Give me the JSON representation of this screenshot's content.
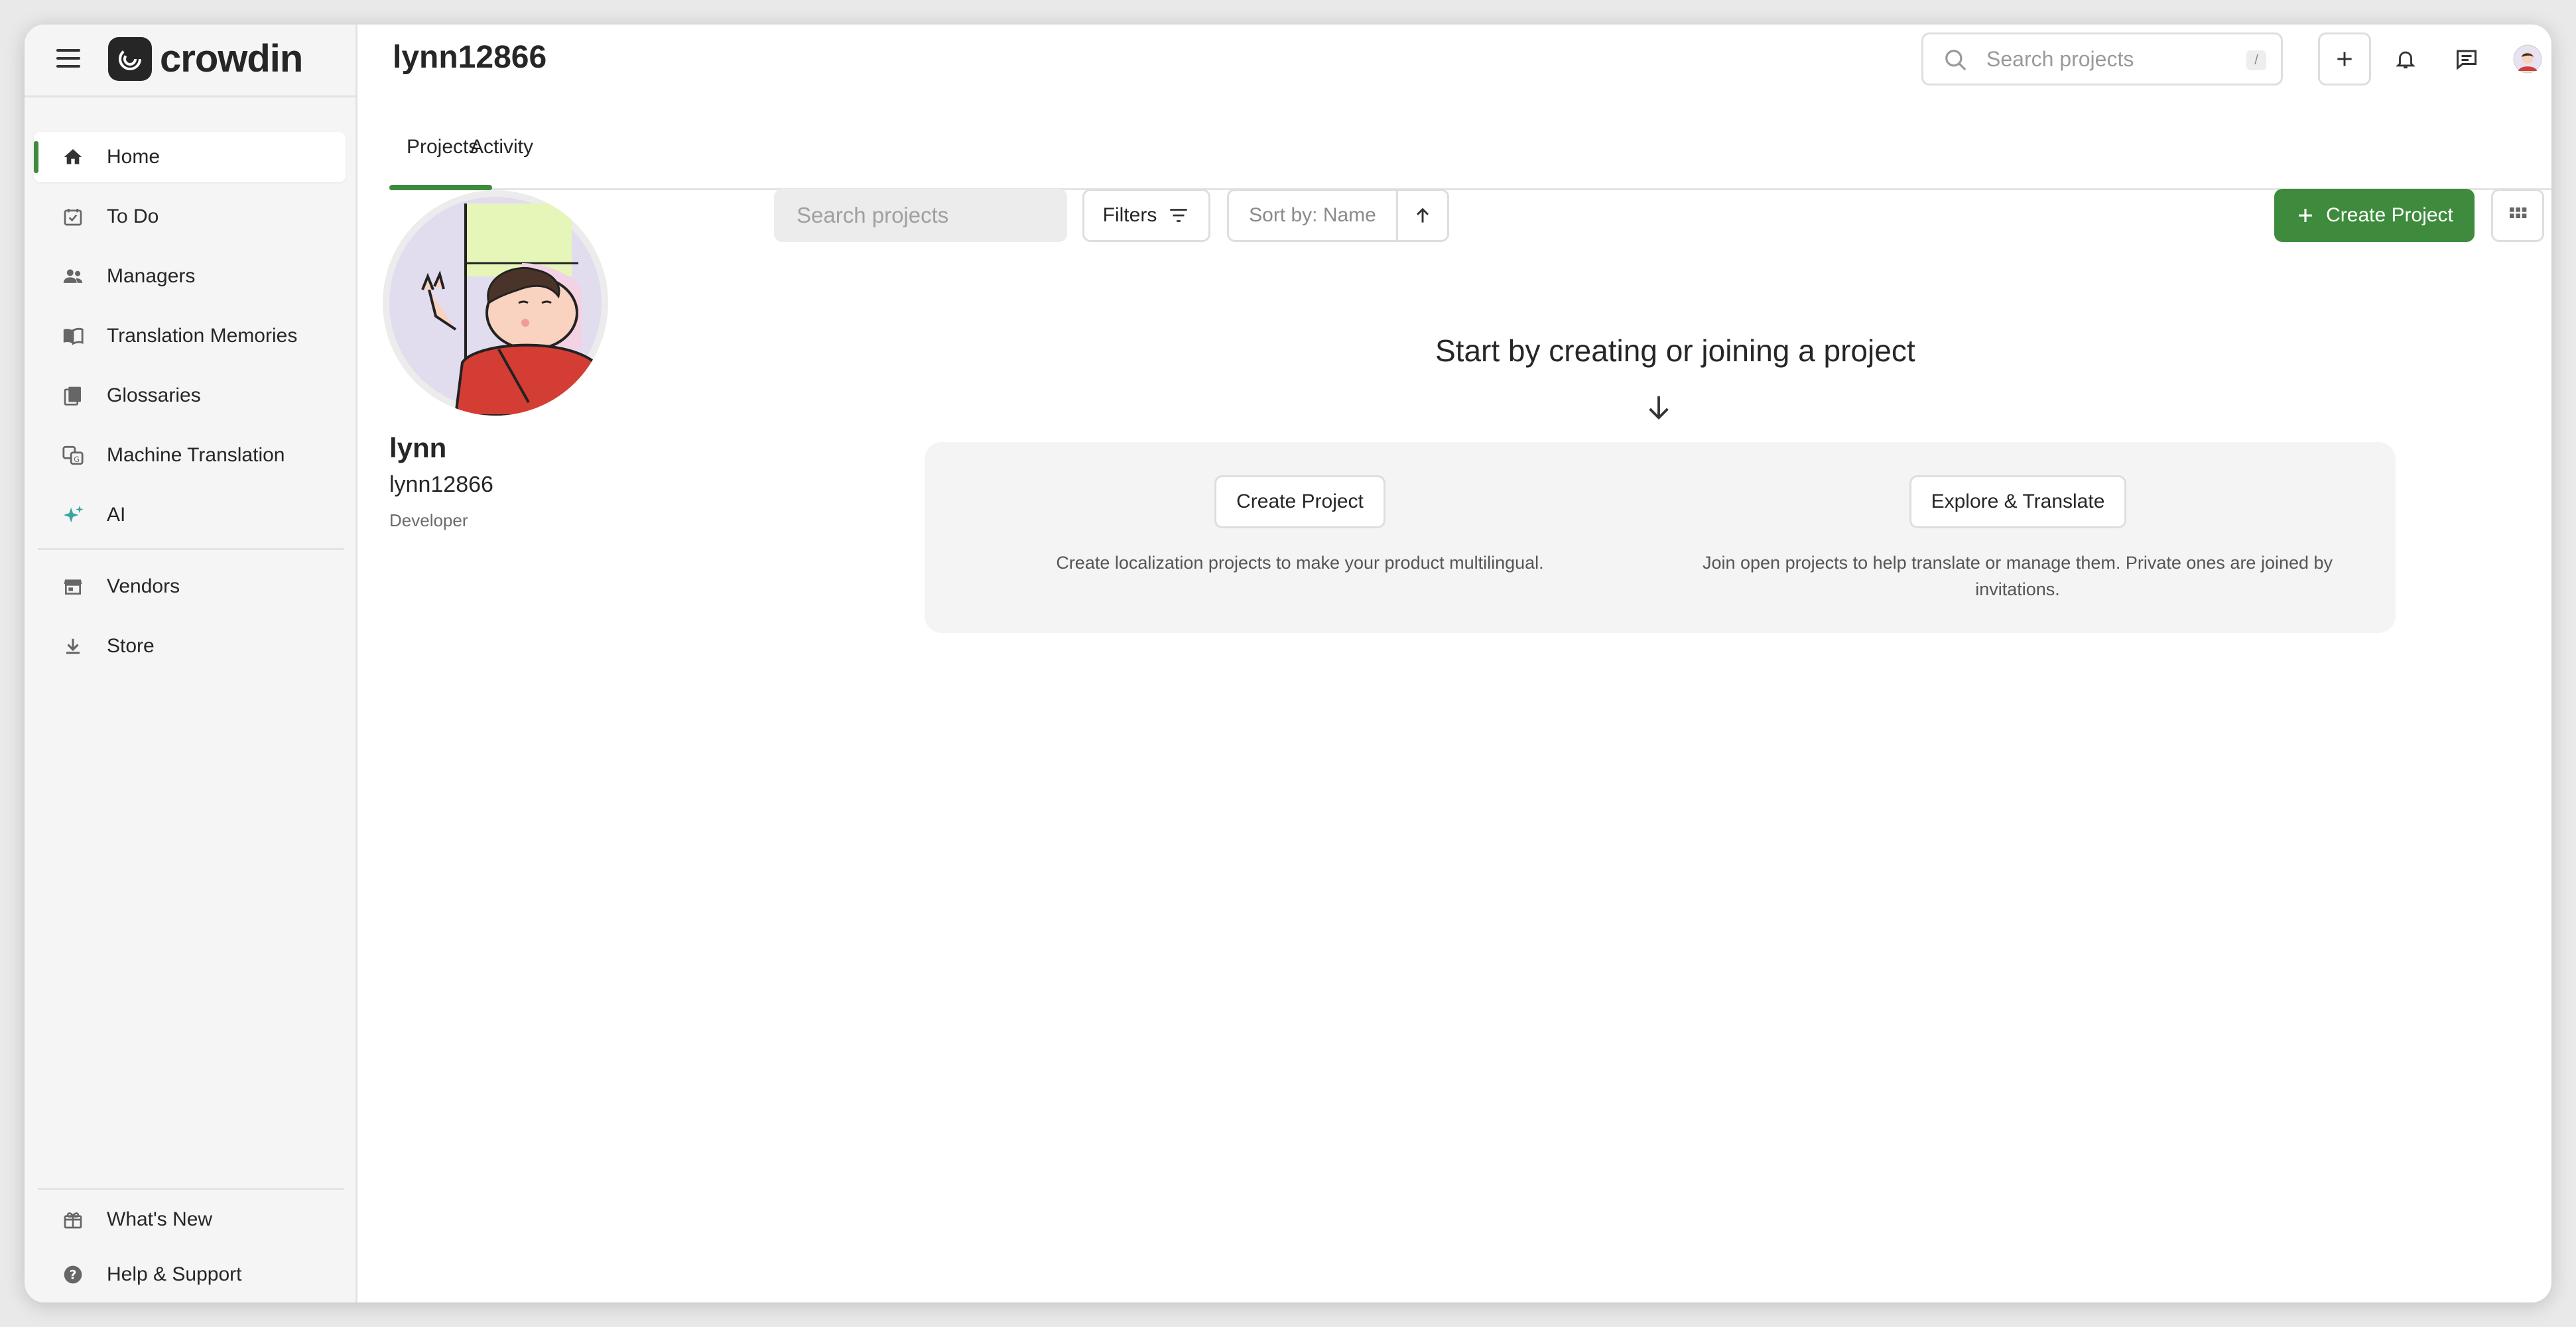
{
  "app": {
    "logo_text": "crowdin"
  },
  "sidebar": {
    "items": [
      {
        "label": "Home",
        "icon": "home-icon"
      },
      {
        "label": "To Do",
        "icon": "calendar-check-icon"
      },
      {
        "label": "Managers",
        "icon": "people-icon"
      },
      {
        "label": "Translation Memories",
        "icon": "book-icon"
      },
      {
        "label": "Glossaries",
        "icon": "glossary-icon"
      },
      {
        "label": "Machine Translation",
        "icon": "machine-translation-icon"
      },
      {
        "label": "AI",
        "icon": "sparkle-icon"
      },
      {
        "label": "Vendors",
        "icon": "store-front-icon"
      },
      {
        "label": "Store",
        "icon": "download-icon"
      }
    ],
    "footer": [
      {
        "label": "What's New",
        "icon": "gift-icon"
      },
      {
        "label": "Help & Support",
        "icon": "help-icon"
      }
    ]
  },
  "header": {
    "title": "lynn12866",
    "search_placeholder": "Search projects",
    "search_shortcut": "/"
  },
  "tabs": [
    {
      "label": "Projects"
    },
    {
      "label": "Activity"
    }
  ],
  "profile": {
    "name": "lynn",
    "username": "lynn12866",
    "role": "Developer"
  },
  "toolbar": {
    "search_placeholder": "Search projects",
    "filters_label": "Filters",
    "sort_label": "Sort by: Name",
    "create_label": "Create Project"
  },
  "empty_state": {
    "headline": "Start by creating or joining a project",
    "create": {
      "button": "Create Project",
      "description": "Create localization projects to make your product multilingual."
    },
    "explore": {
      "button": "Explore & Translate",
      "description_line1": "Join open projects to help translate or manage them. Private ones are joined by",
      "description_line2": "invitations."
    }
  },
  "colors": {
    "accent": "#3e8b3e",
    "sidebar_bg": "#f5f5f5",
    "panel_bg": "#f4f4f4"
  }
}
